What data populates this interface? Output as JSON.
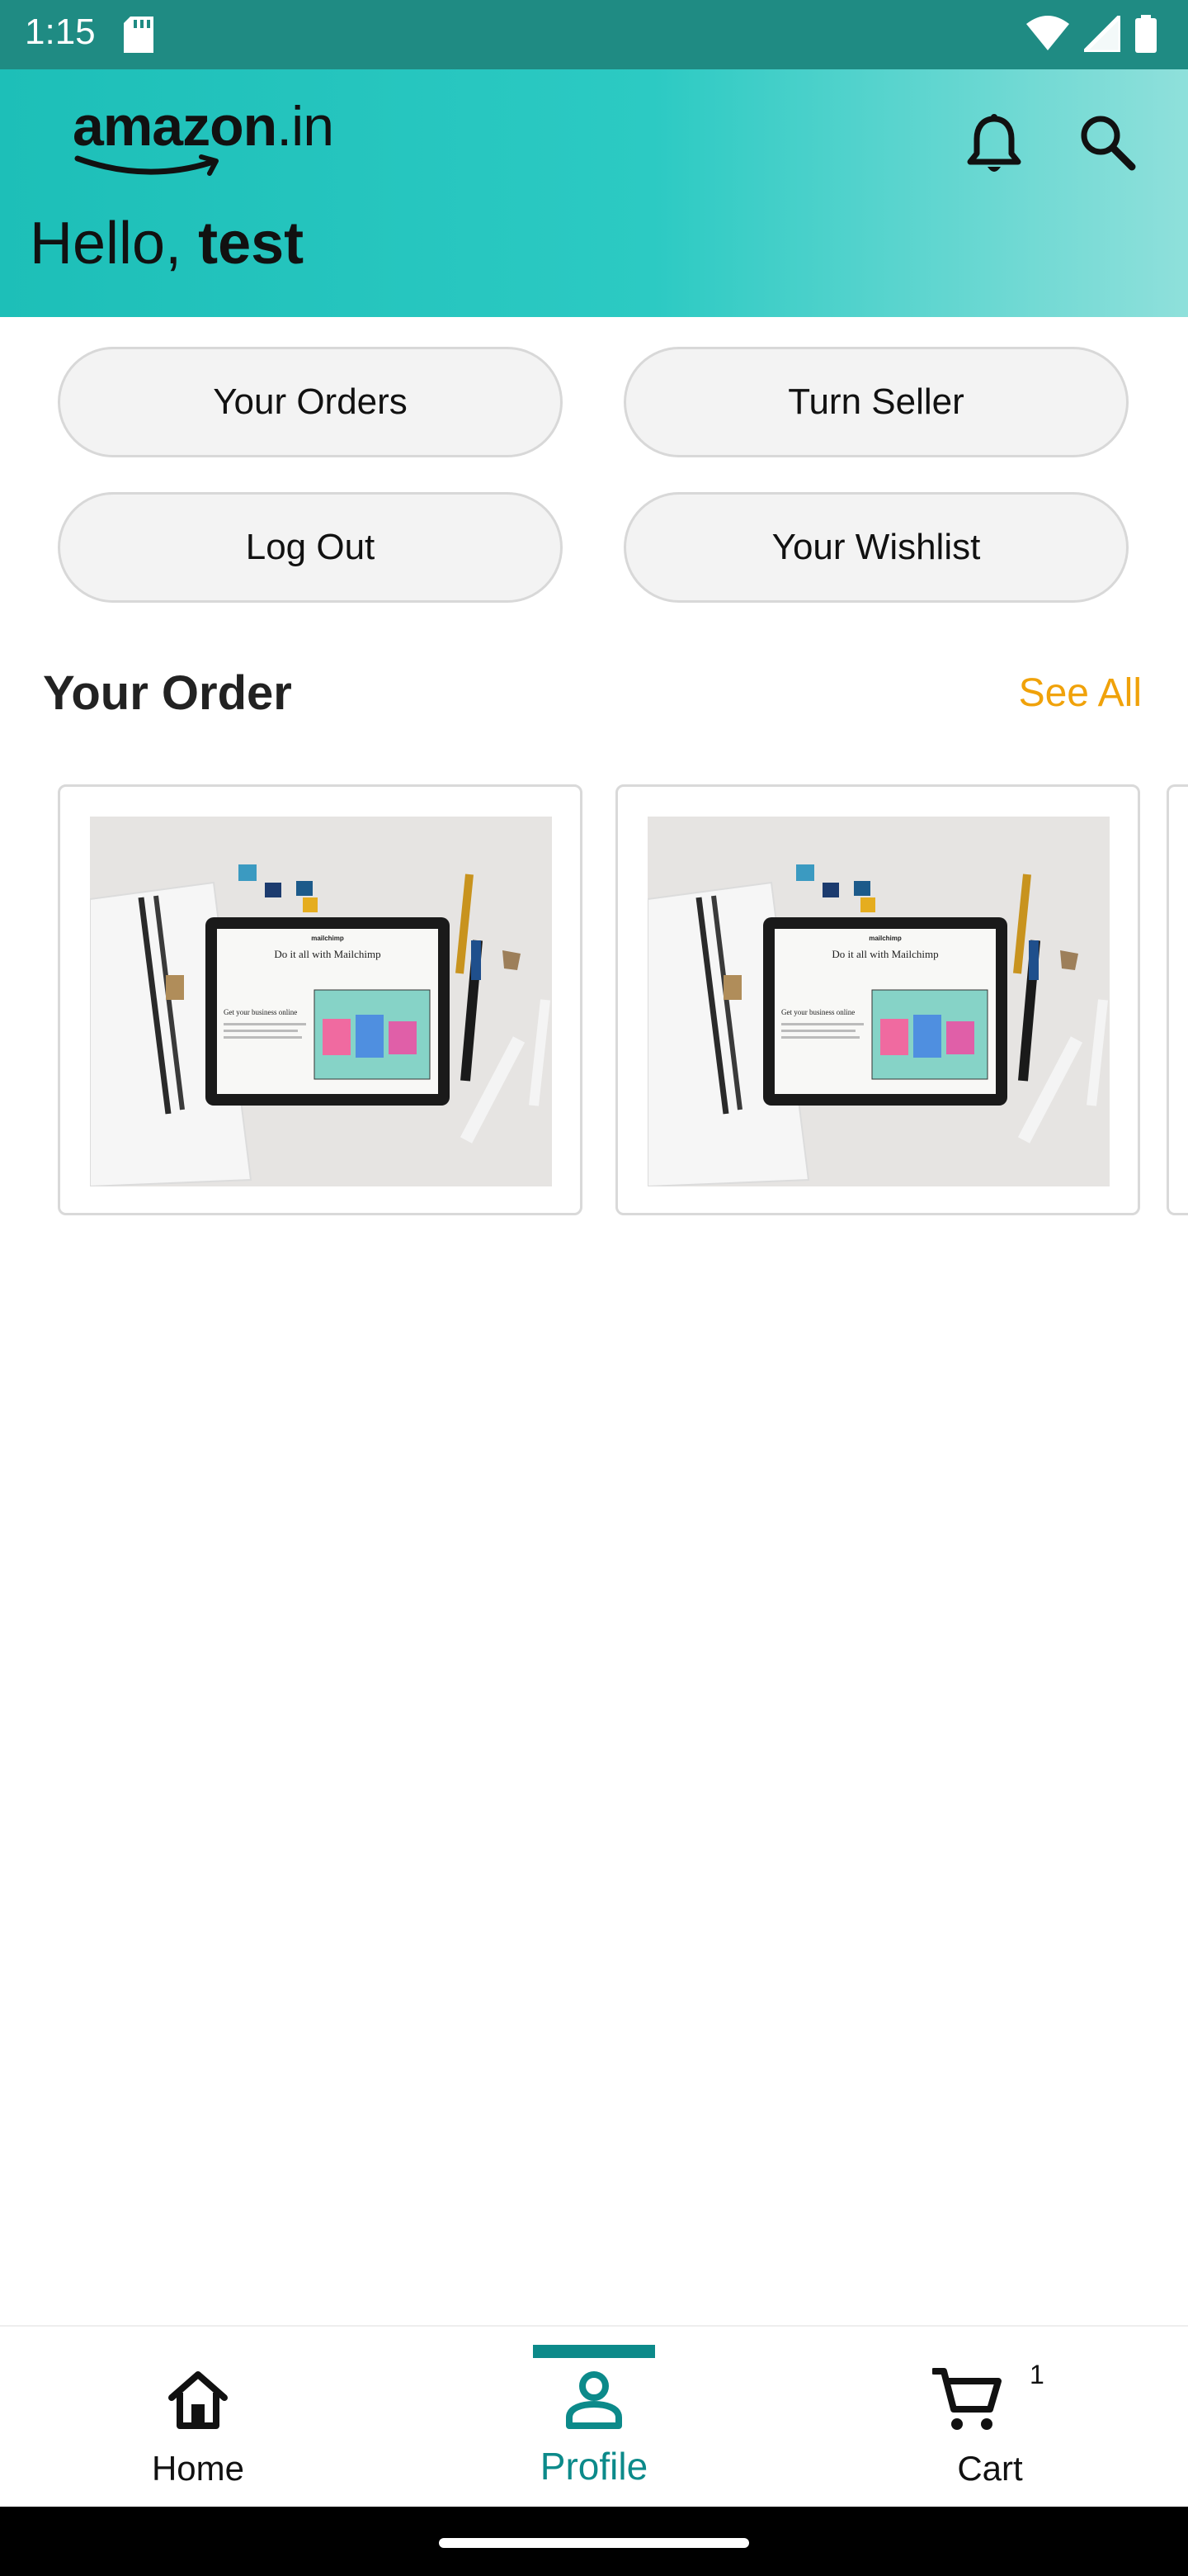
{
  "status_bar": {
    "time": "1:15"
  },
  "header": {
    "logo_main": "amazon",
    "logo_tld": ".in",
    "greeting_prefix": "Hello, ",
    "user_name": "test"
  },
  "account_buttons": {
    "orders": "Your Orders",
    "seller": "Turn Seller",
    "logout": "Log Out",
    "wishlist": "Your Wishlist"
  },
  "orders_section": {
    "title": "Your Order",
    "see_all": "See All",
    "tablet_heading": "Do it all with Mailchimp",
    "tablet_sub": "Get your business online",
    "tablet_brand": "mailchimp"
  },
  "bottom_nav": {
    "home": "Home",
    "profile": "Profile",
    "cart": "Cart",
    "cart_count": "1",
    "active": "profile"
  },
  "colors": {
    "accent": "#0c8a8a",
    "see_all": "#f0a20a",
    "header_start": "#1dbfb8",
    "header_end": "#8fe0db"
  },
  "icons": [
    "sd-card-icon",
    "wifi-icon",
    "signal-icon",
    "battery-icon",
    "bell-icon",
    "search-icon",
    "home-icon",
    "profile-icon",
    "cart-icon"
  ]
}
